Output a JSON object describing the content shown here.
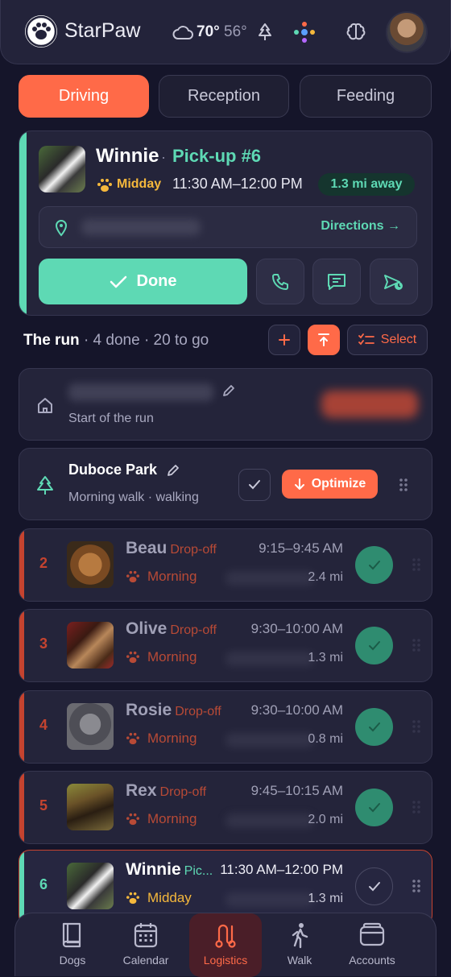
{
  "header": {
    "brand": "StarPaw",
    "weather_hi": "70°",
    "weather_lo": "56°"
  },
  "tabs": [
    "Driving",
    "Reception",
    "Feeding"
  ],
  "current": {
    "name": "Winnie",
    "sep": "·",
    "action": "Pick-up #6",
    "period": "Midday",
    "time": "11:30 AM–12:00 PM",
    "distance": "1.3 mi away",
    "directions": "Directions →",
    "done": "Done"
  },
  "run": {
    "title": "The run",
    "summary": "· 4 done · 20 to go",
    "select": "Select"
  },
  "start": {
    "label": "Start of the run"
  },
  "park": {
    "name": "Duboce Park",
    "sub": "Morning walk · walking",
    "optimize": "Optimize"
  },
  "stops": [
    {
      "num": "2",
      "name": "Beau",
      "type": "Drop-off",
      "period": "Morning",
      "time": "9:15–9:45 AM",
      "dist": "2.4 mi"
    },
    {
      "num": "3",
      "name": "Olive",
      "type": "Drop-off",
      "period": "Morning",
      "time": "9:30–10:00 AM",
      "dist": "1.3 mi"
    },
    {
      "num": "4",
      "name": "Rosie",
      "type": "Drop-off",
      "period": "Morning",
      "time": "9:30–10:00 AM",
      "dist": "0.8 mi"
    },
    {
      "num": "5",
      "name": "Rex",
      "type": "Drop-off",
      "period": "Morning",
      "time": "9:45–10:15 AM",
      "dist": "2.0 mi"
    },
    {
      "num": "6",
      "name": "Winnie",
      "type": "Pic...",
      "period": "Midday",
      "time": "11:30 AM–12:00 PM",
      "dist": "1.3 mi"
    }
  ],
  "nav": [
    "Dogs",
    "Calendar",
    "Logistics",
    "Walk",
    "Accounts"
  ],
  "colors": {
    "accent": "#ff6a48",
    "teal": "#5ed9b4",
    "amber": "#f5b83c",
    "dropoff": "#c5432f"
  }
}
